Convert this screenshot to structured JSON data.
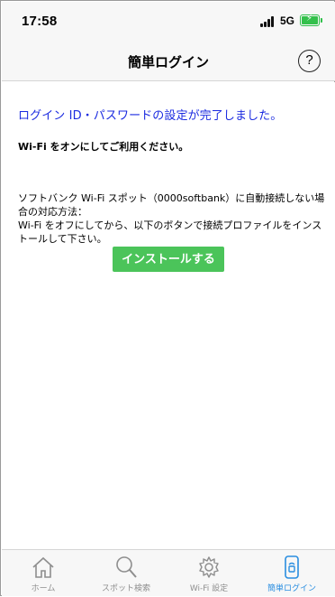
{
  "status_bar": {
    "time": "17:58",
    "network": "5G",
    "icons": [
      "signal-icon",
      "battery-charging-icon"
    ]
  },
  "nav": {
    "title": "簡単ログイン",
    "help_label": "?"
  },
  "content": {
    "completion_message": "ログイン ID・パスワードの設定が完了しました。",
    "wifi_instruction": "Wi-Fi をオンにしてご利用ください。",
    "note_lines": [
      "ソフトバンク Wi-Fi スポット（0000softbank）に自動接続しない場",
      "合の対応方法：",
      "Wi-Fi をオフにしてから、以下のボタンで接続プロファイルをインス",
      "トールして下さい。"
    ],
    "install_button": "インストールする"
  },
  "tabs": [
    {
      "label": "ホーム",
      "icon": "home-icon",
      "active": false
    },
    {
      "label": "スポット検索",
      "icon": "search-icon",
      "active": false
    },
    {
      "label": "Wi-Fi 設定",
      "icon": "gear-icon",
      "active": false
    },
    {
      "label": "簡単ログイン",
      "icon": "phone-login-icon",
      "active": true
    }
  ],
  "colors": {
    "accent_blue": "#1b2be0",
    "install_green": "#4bc45a",
    "active_tab": "#2a8ee0",
    "inactive_tab": "#8e8e8e",
    "battery_green": "#33c04b"
  }
}
